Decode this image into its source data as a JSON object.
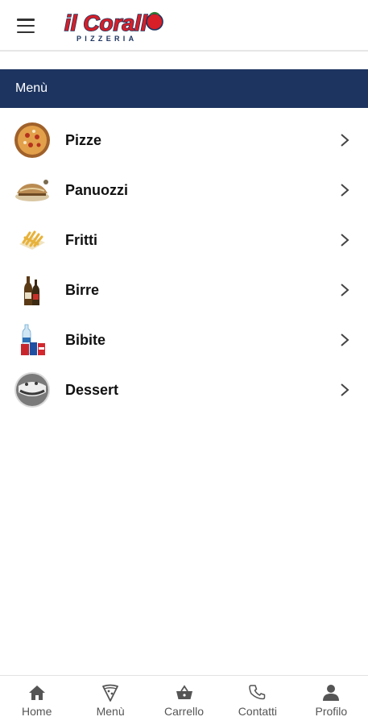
{
  "header": {
    "logo_text": "il Corallo",
    "logo_subtext": "PIZZERIA"
  },
  "section": {
    "title": "Menù"
  },
  "menu": {
    "items": [
      {
        "label": "Pizze",
        "icon": "pizza-icon"
      },
      {
        "label": "Panuozzi",
        "icon": "panuozzo-icon"
      },
      {
        "label": "Fritti",
        "icon": "fries-icon"
      },
      {
        "label": "Birre",
        "icon": "beer-bottles-icon"
      },
      {
        "label": "Bibite",
        "icon": "drinks-icon"
      },
      {
        "label": "Dessert",
        "icon": "dessert-icon"
      }
    ]
  },
  "bottom_nav": {
    "items": [
      {
        "label": "Home",
        "icon": "home-icon"
      },
      {
        "label": "Menù",
        "icon": "pizza-slice-icon"
      },
      {
        "label": "Carrello",
        "icon": "basket-icon"
      },
      {
        "label": "Contatti",
        "icon": "phone-icon"
      },
      {
        "label": "Profilo",
        "icon": "user-icon"
      }
    ]
  },
  "colors": {
    "header_bar": "#1d3460",
    "logo_red": "#d81e27",
    "logo_navy": "#1d3460"
  }
}
